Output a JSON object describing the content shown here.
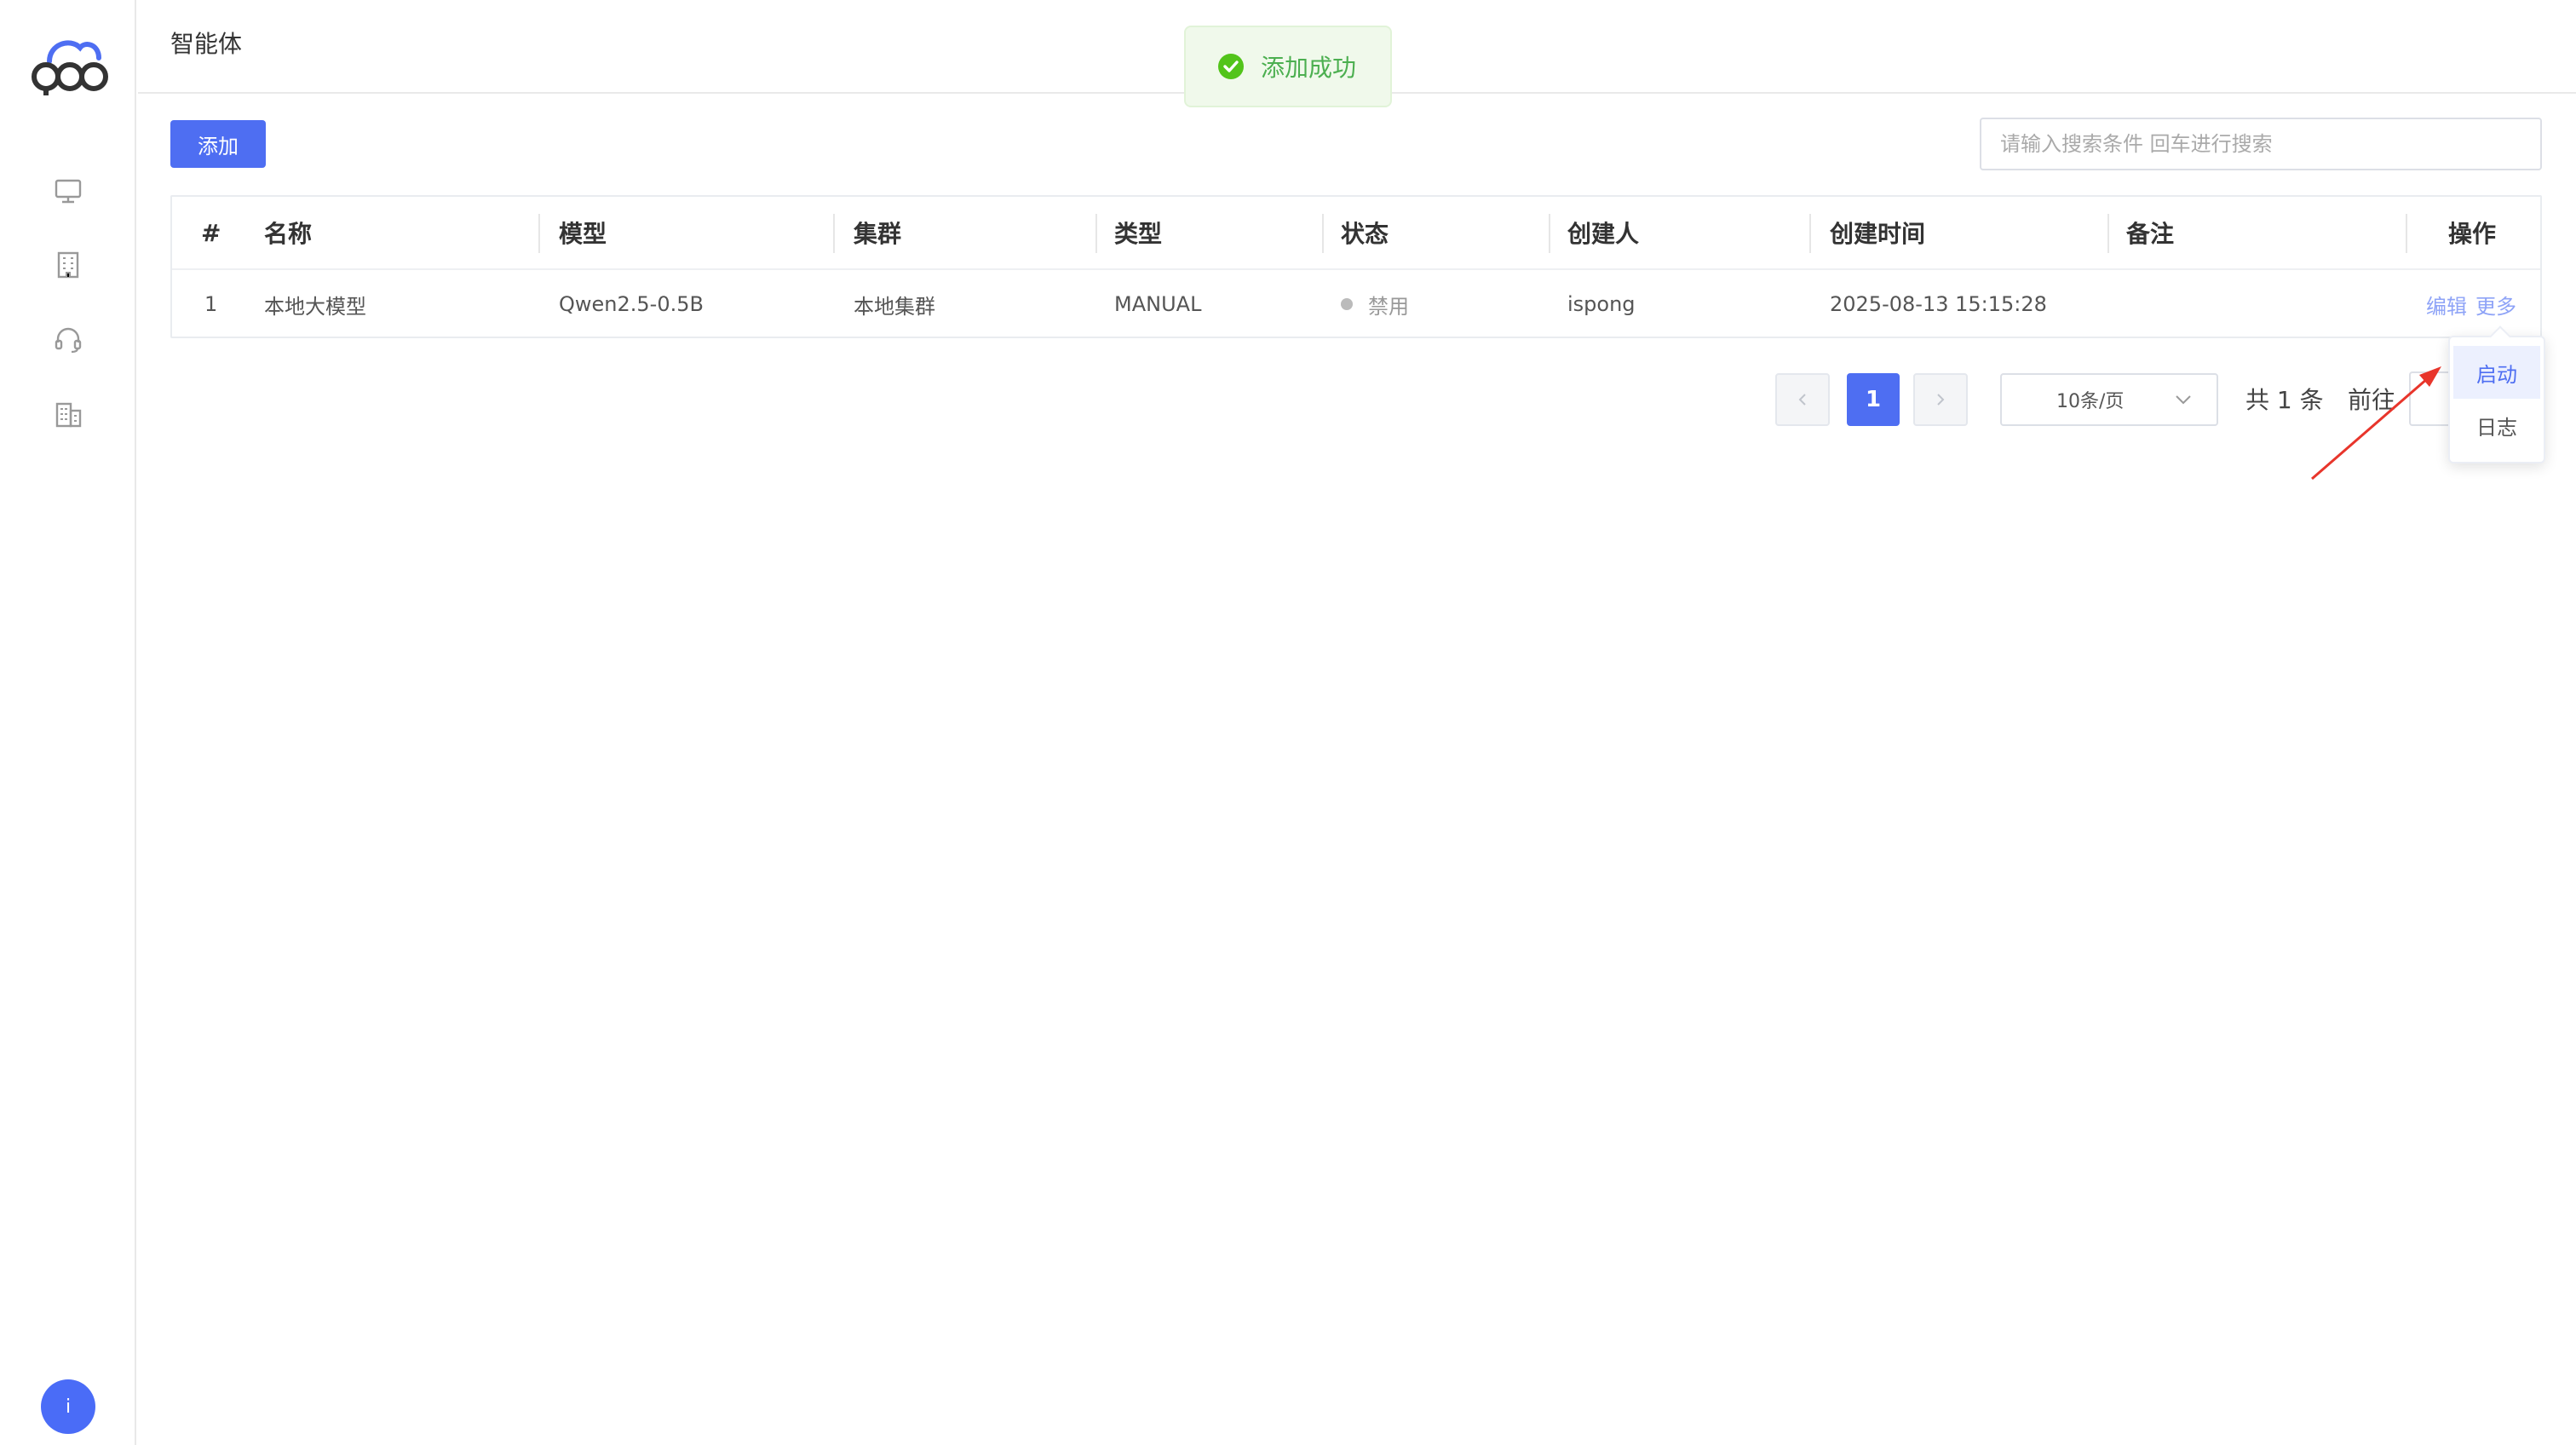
{
  "header": {
    "title": "智能体"
  },
  "toast": {
    "message": "添加成功",
    "color": "#4caf50"
  },
  "toolbar": {
    "add_label": "添加",
    "search_placeholder": "请输入搜索条件 回车进行搜索"
  },
  "table": {
    "columns": [
      "#",
      "名称",
      "模型",
      "集群",
      "类型",
      "状态",
      "创建人",
      "创建时间",
      "备注",
      "操作"
    ],
    "rows": [
      {
        "index": "1",
        "name": "本地大模型",
        "model": "Qwen2.5-0.5B",
        "cluster": "本地集群",
        "type": "MANUAL",
        "status": "禁用",
        "creator": "ispong",
        "created_at": "2025-08-13 15:15:28",
        "remark": "",
        "actions": {
          "edit": "编辑",
          "more": "更多"
        }
      }
    ]
  },
  "pagination": {
    "current_page": "1",
    "page_size": "10条/页",
    "total": "共 1 条",
    "goto": "前往"
  },
  "dropdown": {
    "items": [
      "启动",
      "日志"
    ]
  },
  "user": {
    "avatar_letter": "i"
  },
  "colors": {
    "primary": "#4e6ef2",
    "annotation": "#e8352b"
  }
}
